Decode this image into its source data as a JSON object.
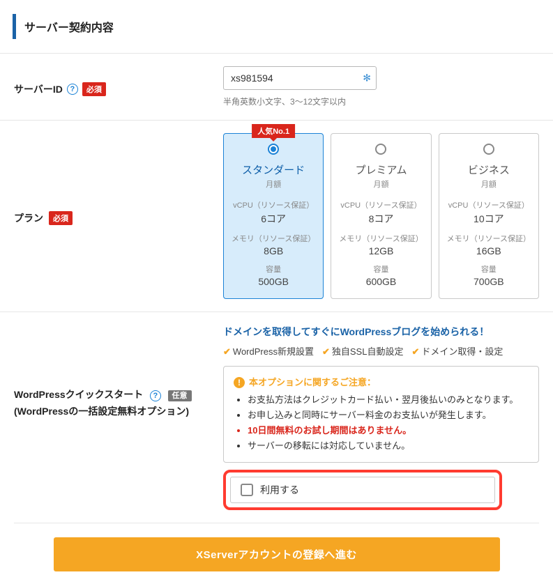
{
  "section_title": "サーバー契約内容",
  "server_id": {
    "label": "サーバーID",
    "required_badge": "必須",
    "value": "xs981594",
    "hint": "半角英数小文字、3～12文字以内"
  },
  "plan": {
    "label": "プラン",
    "required_badge": "必須",
    "popular_tag": "人気No.1",
    "spec_labels": {
      "vcpu": "vCPU（リソース保証）",
      "memory": "メモリ（リソース保証）",
      "capacity": "容量"
    },
    "per_month": "月額",
    "options": [
      {
        "name": "スタンダード",
        "vcpu": "6コア",
        "memory": "8GB",
        "capacity": "500GB",
        "selected": true,
        "popular": true
      },
      {
        "name": "プレミアム",
        "vcpu": "8コア",
        "memory": "12GB",
        "capacity": "600GB",
        "selected": false,
        "popular": false
      },
      {
        "name": "ビジネス",
        "vcpu": "10コア",
        "memory": "16GB",
        "capacity": "700GB",
        "selected": false,
        "popular": false
      }
    ]
  },
  "wordpress": {
    "label": "WordPressクイックスタート",
    "sub_label": "(WordPressの一括設定無料オプション)",
    "optional_badge": "任意",
    "heading": "ドメインを取得してすぐにWordPressブログを始められる！",
    "features": [
      "WordPress新規設置",
      "独自SSL自動設定",
      "ドメイン取得・設定"
    ],
    "notice_title": "本オプションに関するご注意：",
    "notice_items": [
      {
        "text": "お支払方法はクレジットカード払い・翌月後払いのみとなります。",
        "red": false
      },
      {
        "text": "お申し込みと同時にサーバー料金のお支払いが発生します。",
        "red": false
      },
      {
        "text": "10日間無料のお試し期間はありません。",
        "red": true
      },
      {
        "text": "サーバーの移転には対応していません。",
        "red": false
      }
    ],
    "use_label": "利用する"
  },
  "submit_label": "XServerアカウントの登録へ進む"
}
